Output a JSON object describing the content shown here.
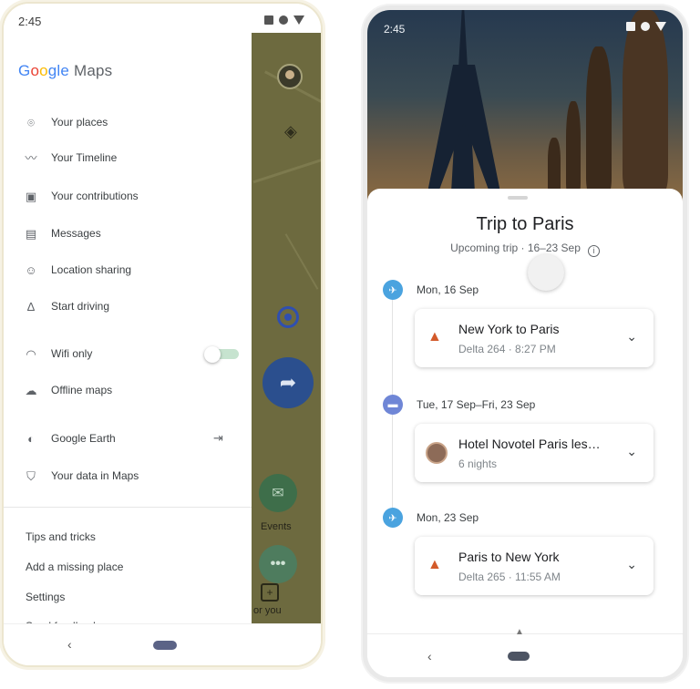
{
  "left_phone": {
    "status_bar": {
      "time": "2:45"
    },
    "drawer": {
      "logo": {
        "g1": "G",
        "g2": "o",
        "g3": "o",
        "g4": "gle",
        "maps": " Maps"
      },
      "menu": [
        {
          "label": "Your places",
          "icon": "pin-icon"
        },
        {
          "label": "Your Timeline",
          "icon": "timeline-icon"
        },
        {
          "label": "Your contributions",
          "icon": "contributions-icon"
        },
        {
          "label": "Messages",
          "icon": "message-icon"
        },
        {
          "label": "Location sharing",
          "icon": "location-sharing-icon"
        },
        {
          "label": "Start driving",
          "icon": "navigation-icon"
        },
        {
          "label": "Wifi only",
          "icon": "wifi-icon",
          "toggle": "off"
        },
        {
          "label": "Offline maps",
          "icon": "offline-icon"
        },
        {
          "label": "Google Earth",
          "icon": "earth-icon"
        },
        {
          "label": "Your data in Maps",
          "icon": "shield-icon"
        }
      ],
      "footer_links": [
        "Tips and tricks",
        "Add a missing place",
        "Settings",
        "Send feedback"
      ]
    },
    "map": {
      "events_label": "Events",
      "for_you_label": "or you"
    }
  },
  "right_phone": {
    "status_bar": {
      "time": "2:45"
    },
    "trip": {
      "title": "Trip to Paris",
      "subtitle": "Upcoming trip · 16–23 Sep",
      "items": [
        {
          "date": "Mon, 16 Sep",
          "title": "New York to Paris",
          "subtitle": "Delta 264 · 8:27 PM",
          "dot_color": "#4aa3df",
          "icon": "flight-icon"
        },
        {
          "date": "Tue, 17 Sep–Fri, 23 Sep",
          "title": "Hotel Novotel Paris les…",
          "subtitle": "6 nights",
          "dot_color": "#6f86d6",
          "icon": "hotel-icon"
        },
        {
          "date": "Mon, 23 Sep",
          "title": "Paris to New York",
          "subtitle": "Delta 265 · 11:55 AM",
          "dot_color": "#4aa3df",
          "icon": "flight-icon"
        }
      ]
    }
  }
}
